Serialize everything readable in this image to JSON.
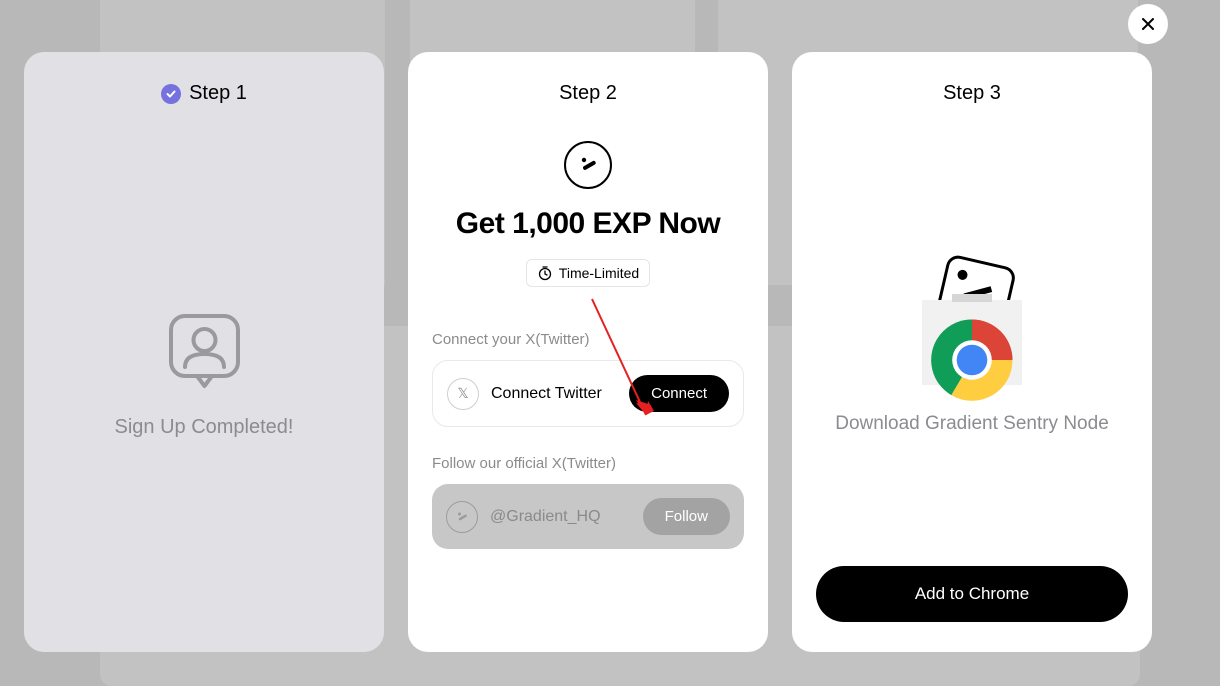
{
  "step1": {
    "label": "Step 1",
    "completed": true,
    "message": "Sign Up Completed!"
  },
  "step2": {
    "label": "Step 2",
    "title": "Get 1,000 EXP Now",
    "time_limited": "Time-Limited",
    "connect_section_label": "Connect your X(Twitter)",
    "connect_label": "Connect Twitter",
    "connect_button": "Connect",
    "follow_section_label": "Follow our official X(Twitter)",
    "follow_handle": "@Gradient_HQ",
    "follow_button": "Follow"
  },
  "step3": {
    "label": "Step 3",
    "message": "Download Gradient Sentry Node",
    "button": "Add to Chrome"
  }
}
